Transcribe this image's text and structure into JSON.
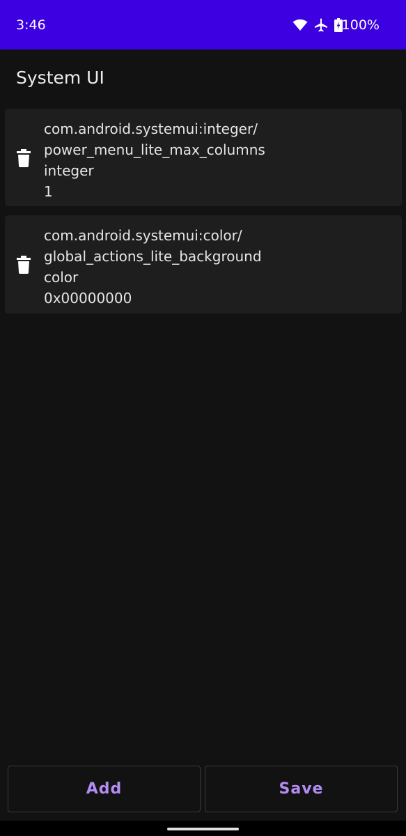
{
  "status_bar": {
    "time": "3:46",
    "battery_percent": "100%",
    "icons": [
      "wifi-icon",
      "airplane-icon",
      "battery-charging-icon"
    ],
    "background_color": "#3d00e0"
  },
  "page": {
    "title": "System UI"
  },
  "entries": [
    {
      "name_line1": "com.android.systemui:integer/",
      "name_line2": "power_menu_lite_max_columns",
      "type": "integer",
      "value": "1",
      "icon": "trash-icon"
    },
    {
      "name_line1": "com.android.systemui:color/",
      "name_line2": "global_actions_lite_background",
      "type": "color",
      "value": "0x00000000",
      "icon": "trash-icon"
    }
  ],
  "actions": {
    "add_label": "Add",
    "save_label": "Save",
    "accent_color": "#b38cf4"
  }
}
